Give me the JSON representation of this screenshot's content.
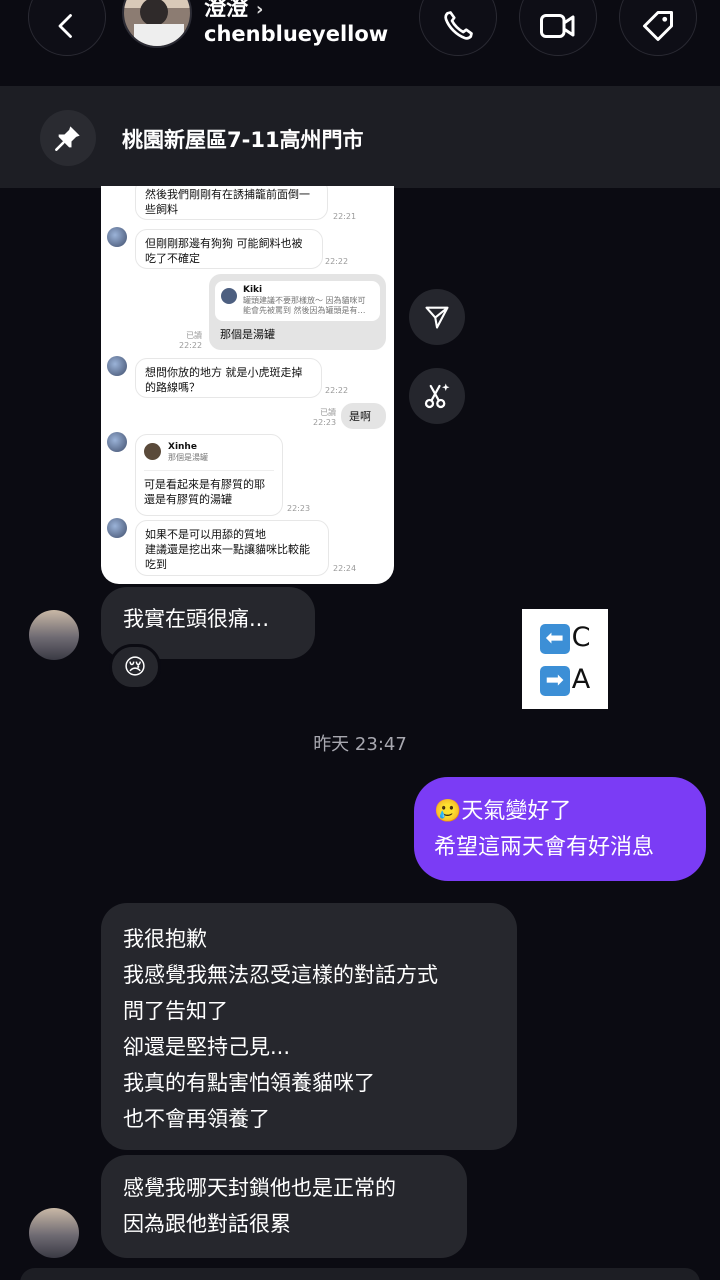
{
  "header": {
    "display_name": "澄澄",
    "username": "chenblueyellow",
    "chevron": "›"
  },
  "pinned": {
    "text": "桃園新屋區7-11高州門市"
  },
  "screenshot": {
    "messages": [
      {
        "type": "in",
        "text": "然後我們剛剛有在誘捕籠前面倒一\n些飼料",
        "time": "22:21"
      },
      {
        "type": "in",
        "text": "但剛剛那邊有狗狗 可能飼料也被\n吃了不確定",
        "time": "22:22"
      },
      {
        "type": "out_reply",
        "reply_name": "Kiki",
        "reply_text": "罐頭建議不要那樣放～ 因為貓咪可\n能會先被罵到 然後因為罐頭是有…",
        "text": "那個是湯罐",
        "read": "已讀",
        "time": "22:22"
      },
      {
        "type": "in",
        "text": "想問你放的地方 就是小虎斑走掉\n的路線嗎？",
        "time": "22:22"
      },
      {
        "type": "out",
        "text": "是啊",
        "read": "已讀",
        "time": "22:23"
      },
      {
        "type": "in_reply",
        "reply_name": "Xinhe",
        "reply_text": "那個是湯罐",
        "text": "可是看起來是有膠質的耶\n還是有膠質的湯罐",
        "time": "22:23"
      },
      {
        "type": "in",
        "text": "如果不是可以用舔的質地\n建議還是挖出來一點讓貓咪比較能\n吃到",
        "time": "22:24"
      }
    ]
  },
  "chat": {
    "msg_headache": "我實在頭很痛...",
    "reaction": "😢",
    "sticker_line1": "C",
    "sticker_line2": "A",
    "sticker_key1": "⬅",
    "sticker_key2": "➡",
    "timestamp": "昨天 23:47",
    "out_line1": "🥲天氣變好了",
    "out_line2": "希望這兩天會有好消息",
    "long_msg": [
      "我很抱歉",
      "我感覺我無法忍受這樣的對話方式",
      "問了告知了",
      "卻還是堅持己見...",
      "我真的有點害怕領養貓咪了",
      "也不會再領養了"
    ],
    "last_msg": [
      "感覺我哪天封鎖他也是正常的",
      "因為跟他對話很累"
    ]
  },
  "icons": {
    "back": "back-arrow-icon",
    "call": "phone-icon",
    "video": "video-camera-icon",
    "tag": "tag-icon",
    "pin": "pin-icon",
    "share": "send-icon",
    "ai": "scissors-sparkle-icon"
  }
}
